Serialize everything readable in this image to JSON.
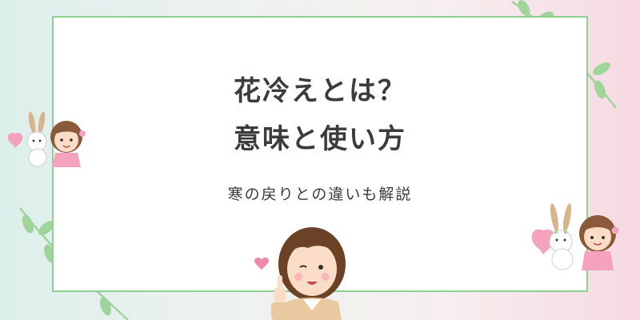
{
  "header": {
    "title_line1": "花冷えとは？",
    "title_line2": "意味と使い方",
    "subtitle": "寒の戻りとの違いも解説"
  },
  "theme": {
    "frame_green": "#8fcf8f",
    "leaf_green": "#9fd49b",
    "heart_pink": "#f5a3bd",
    "text": "#3b3b3b"
  },
  "illustrations": [
    "vine-icon",
    "girl-and-bunny-icon",
    "heart-icon",
    "pointing-woman-icon"
  ]
}
